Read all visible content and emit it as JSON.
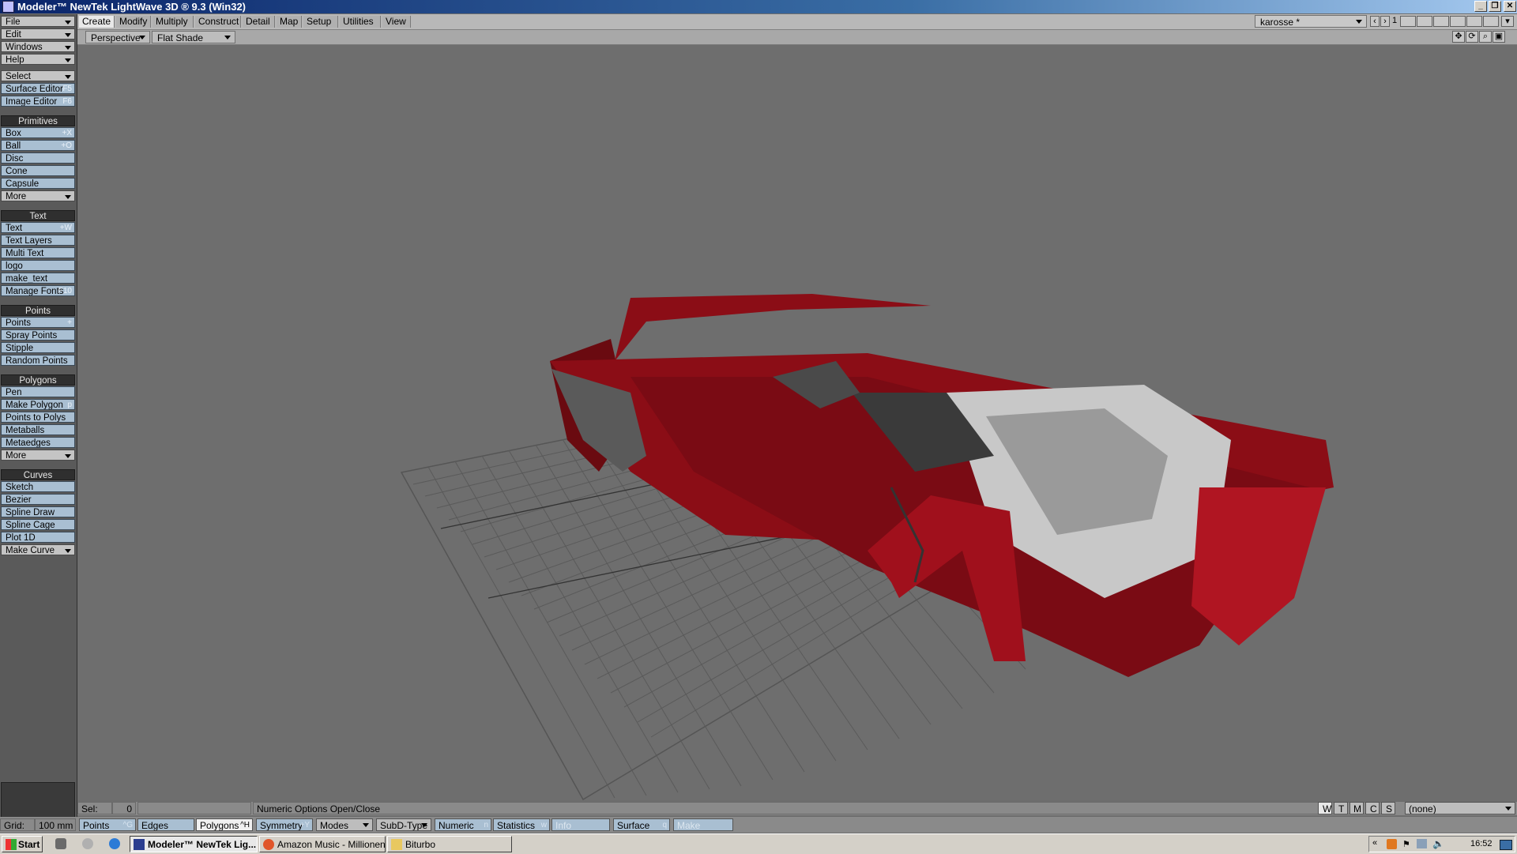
{
  "window": {
    "title": "Modeler™ NewTek LightWave 3D ® 9.3 (Win32)",
    "controls": [
      "_",
      "❐",
      "✕"
    ]
  },
  "tabs": [
    {
      "label": "Create",
      "active": true
    },
    {
      "label": "Modify"
    },
    {
      "label": "Multiply"
    },
    {
      "label": "Construct"
    },
    {
      "label": "Detail"
    },
    {
      "label": "Map"
    },
    {
      "label": "Setup"
    },
    {
      "label": "Utilities"
    },
    {
      "label": "View"
    }
  ],
  "layer_select": {
    "value": "karosse *",
    "layer_number": "1"
  },
  "left_menu": {
    "top": [
      "File",
      "Edit",
      "Windows",
      "Help"
    ],
    "select": "Select",
    "editors": [
      {
        "label": "Surface Editor",
        "key": "F5"
      },
      {
        "label": "Image Editor",
        "key": "F6"
      }
    ],
    "primitives": {
      "header": "Primitives",
      "items": [
        {
          "label": "Box",
          "key": "+X"
        },
        {
          "label": "Ball",
          "key": "+O"
        },
        {
          "label": "Disc",
          "key": ""
        },
        {
          "label": "Cone",
          "key": ""
        },
        {
          "label": "Capsule",
          "key": ""
        }
      ],
      "more": "More"
    },
    "text": {
      "header": "Text",
      "items": [
        {
          "label": "Text",
          "key": "+W"
        },
        {
          "label": "Text Layers",
          "key": ""
        },
        {
          "label": "Multi Text",
          "key": ""
        },
        {
          "label": "logo",
          "key": ""
        },
        {
          "label": "make_text",
          "key": ""
        },
        {
          "label": "Manage Fonts",
          "key": "F10"
        }
      ]
    },
    "points": {
      "header": "Points",
      "items": [
        {
          "label": "Points",
          "key": "+"
        },
        {
          "label": "Spray Points",
          "key": ""
        },
        {
          "label": "Stipple",
          "key": ""
        },
        {
          "label": "Random Points",
          "key": ""
        }
      ]
    },
    "polygons": {
      "header": "Polygons",
      "items": [
        {
          "label": "Pen",
          "key": ""
        },
        {
          "label": "Make Polygon",
          "key": "p"
        },
        {
          "label": "Points to Polys",
          "key": ""
        },
        {
          "label": "Metaballs",
          "key": ""
        },
        {
          "label": "Metaedges",
          "key": ""
        }
      ],
      "more": "More"
    },
    "curves": {
      "header": "Curves",
      "items": [
        {
          "label": "Sketch",
          "key": ""
        },
        {
          "label": "Bezier",
          "key": ""
        },
        {
          "label": "Spline Draw",
          "key": ""
        },
        {
          "label": "Spline Cage",
          "key": ""
        },
        {
          "label": "Plot 1D",
          "key": ""
        }
      ],
      "make_curve": "Make Curve"
    }
  },
  "viewport": {
    "view_mode": "Perspective",
    "shading": "Flat Shade",
    "model_color": "#8b0d16"
  },
  "status": {
    "sel_label": "Sel:",
    "sel_value": "0",
    "message": "Numeric Options Open/Close",
    "view_toggles": [
      "W",
      "T",
      "M",
      "C",
      "S"
    ],
    "vmap": "(none)"
  },
  "bottom": {
    "grid_label": "Grid:",
    "grid_value": "100 mm",
    "modes": [
      {
        "label": "Points",
        "key": "^G"
      },
      {
        "label": "Edges",
        "key": ""
      },
      {
        "label": "Polygons",
        "key": "^H",
        "active": true
      }
    ],
    "symmetry": {
      "label": "Symmetry",
      "key": "+Y"
    },
    "modes_dd": "Modes",
    "subd": "SubD-Type",
    "numeric": {
      "label": "Numeric",
      "key": "n"
    },
    "statistics": {
      "label": "Statistics",
      "key": "w"
    },
    "info": "Info",
    "surface": {
      "label": "Surface",
      "key": "q"
    },
    "make": "Make"
  },
  "taskbar": {
    "start": "Start",
    "tasks": [
      {
        "label": "Modeler™ NewTek Lig...",
        "active": true
      },
      {
        "label": "Amazon Music - Millionen ..."
      },
      {
        "label": "Biturbo"
      }
    ],
    "clock": "16:52"
  }
}
